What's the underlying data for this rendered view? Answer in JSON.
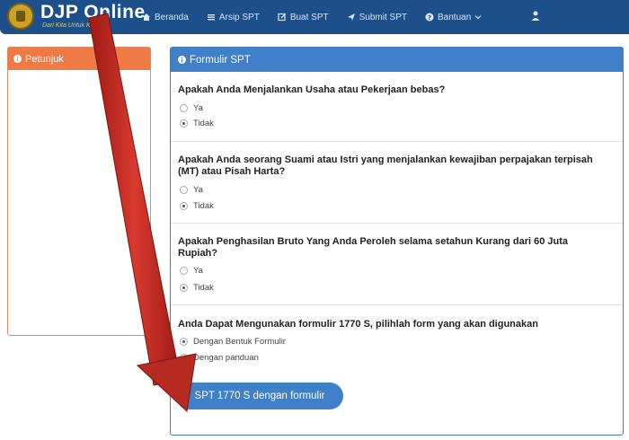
{
  "brand": {
    "name": "DJP Online",
    "tagline": "Dari Kita Untuk Kita"
  },
  "nav": {
    "items": [
      {
        "label": "Beranda",
        "icon": "home-icon"
      },
      {
        "label": "Arsip SPT",
        "icon": "list-icon"
      },
      {
        "label": "Buat SPT",
        "icon": "edit-icon"
      },
      {
        "label": "Submit SPT",
        "icon": "send-icon"
      },
      {
        "label": "Bantuan",
        "icon": "question-icon"
      }
    ],
    "user_icon": "user-icon"
  },
  "petunjuk": {
    "title": "Petunjuk"
  },
  "form": {
    "title": "Formulir SPT",
    "questions": [
      {
        "text": "Apakah Anda Menjalankan Usaha atau Pekerjaan bebas?",
        "options": [
          "Ya",
          "Tidak"
        ],
        "selected": "Tidak"
      },
      {
        "text": "Apakah Anda seorang Suami atau Istri yang menjalankan kewajiban perpajakan terpisah (MT) atau Pisah Harta?",
        "options": [
          "Ya",
          "Tidak"
        ],
        "selected": "Tidak"
      },
      {
        "text": "Apakah Penghasilan Bruto Yang Anda Peroleh selama setahun Kurang dari 60 Juta Rupiah?",
        "options": [
          "Ya",
          "Tidak"
        ],
        "selected": "Tidak"
      },
      {
        "text": "Anda Dapat Mengunakan formulir 1770 S, pilihlah form yang akan digunakan",
        "options": [
          "Dengan Bentuk Formulir",
          "Dengan panduan"
        ],
        "selected": "Dengan Bentuk Formulir"
      }
    ],
    "submit_label": "SPT 1770 S dengan formulir"
  },
  "colors": {
    "navbar": "#1d4f8a",
    "primary": "#3f80c8",
    "petunjuk": "#f07a45",
    "arrow": "#c0261f"
  }
}
